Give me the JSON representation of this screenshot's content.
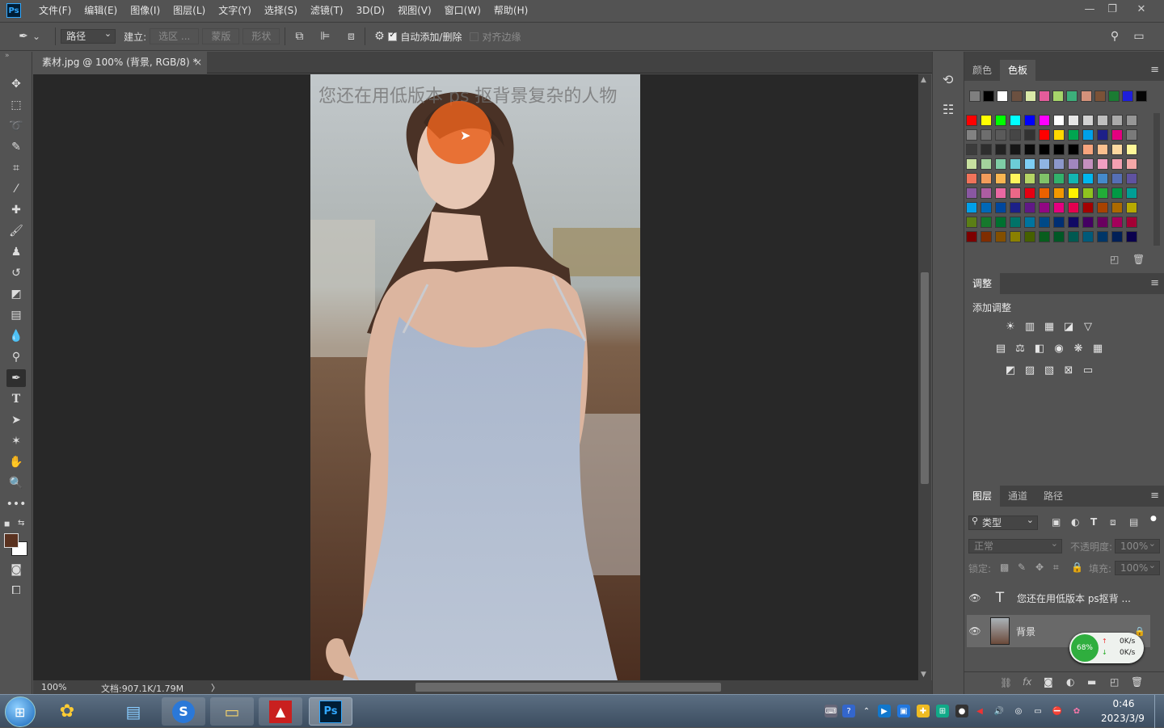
{
  "app": {
    "logo": "Ps"
  },
  "menu": [
    "文件(F)",
    "编辑(E)",
    "图像(I)",
    "图层(L)",
    "文字(Y)",
    "选择(S)",
    "滤镜(T)",
    "3D(D)",
    "视图(V)",
    "窗口(W)",
    "帮助(H)"
  ],
  "window_controls": {
    "minimize": "—",
    "restore": "❐",
    "close": "✕"
  },
  "options": {
    "mode_select": "路径",
    "make_label": "建立:",
    "selection_button": "选区 ...",
    "mask_button": "蒙版",
    "shape_button": "形状",
    "auto_add_delete": "自动添加/删除",
    "align_edges": "对齐边缘"
  },
  "document": {
    "tab_title": "素材.jpg @ 100% (背景, RGB/8) *",
    "tab_close": "×",
    "overlay_text": "您还在用低版本 ps 抠背景复杂的人物",
    "zoom": "100%",
    "doc_info": "文档:907.1K/1.79M",
    "status_arrow": "〉"
  },
  "swatches_panel": {
    "tabs": [
      "颜色",
      "色板"
    ],
    "active_tab": "色板",
    "colors": {
      "row1": [
        "#7f7f7f",
        "#000000",
        "#ffffff",
        "#6b5040",
        "#d9e8a8",
        "#e45c9a",
        "#a6d46a",
        "#3cae7a",
        "#d4927b",
        "#7b5237",
        "#1a7b32",
        "#1e1edc",
        "#050505"
      ],
      "grid": [
        [
          "#ff0000",
          "#ffff00",
          "#00ff00",
          "#00ffff",
          "#0000ff",
          "#ff00ff",
          "#ffffff",
          "#e6e6e6",
          "#d2d2d2",
          "#bebebe",
          "#aaaaaa",
          "#969696"
        ],
        [
          "#828282",
          "#6e6e6e",
          "#5a5a5a",
          "#464646",
          "#323232",
          "#ff0000",
          "#ffd700",
          "#00a550",
          "#00a0e9",
          "#1d2088",
          "#e4007f",
          "#7a7a7a"
        ],
        [
          "#3c3c3c",
          "#2e2e2e",
          "#222222",
          "#161616",
          "#0a0a0a",
          "#000000",
          "#000000",
          "#000000",
          "#f7a47d",
          "#fac08f",
          "#fcd8a0",
          "#fff799"
        ],
        [
          "#c8e1a0",
          "#a3d39c",
          "#7fcca6",
          "#6ccdd7",
          "#7ecef4",
          "#8fb4e3",
          "#8c97cb",
          "#a186be",
          "#c490bf",
          "#f19ec2",
          "#f4a0b1",
          "#f5a7a7"
        ],
        [
          "#f0735a",
          "#f39c5b",
          "#f8b551",
          "#fff45c",
          "#b4d465",
          "#80c269",
          "#32b16c",
          "#13b5b1",
          "#00b7ee",
          "#448aca",
          "#556fb5",
          "#5f52a0"
        ],
        [
          "#8957a1",
          "#ad5da1",
          "#ea68a2",
          "#ec6888",
          "#e60012",
          "#eb6100",
          "#f39800",
          "#fff100",
          "#8fc31f",
          "#22ac38",
          "#009944",
          "#009e96"
        ],
        [
          "#00a0e9",
          "#0068b7",
          "#00479d",
          "#1d2088",
          "#601986",
          "#920783",
          "#e4007f",
          "#e5004f",
          "#a40000",
          "#a84200",
          "#ac6a00",
          "#b7aa00"
        ],
        [
          "#5b7e16",
          "#16782c",
          "#007130",
          "#007368",
          "#00749e",
          "#004987",
          "#002e73",
          "#100964",
          "#440062",
          "#6a005f",
          "#a4005b",
          "#a40035"
        ],
        [
          "#7d0000",
          "#7f2d00",
          "#834f00",
          "#8a8000",
          "#466001",
          "#085d1d",
          "#005826",
          "#005951",
          "#005a7a",
          "#003668",
          "#001f57",
          "#0a004d"
        ]
      ]
    }
  },
  "adjustments_panel": {
    "tab": "调整",
    "add_label": "添加调整"
  },
  "layers_panel": {
    "tabs": [
      "图层",
      "通道",
      "路径"
    ],
    "active_tab": "图层",
    "filter_label": "类型",
    "blend_mode": "正常",
    "opacity_label": "不透明度:",
    "opacity_value": "100%",
    "lock_label": "锁定:",
    "fill_label": "填充:",
    "fill_value": "100%",
    "layers": [
      {
        "name": "您还在用低版本 ps抠背 ...",
        "type": "text"
      },
      {
        "name": "背景",
        "type": "image"
      }
    ]
  },
  "net_widget": {
    "percent": "68%",
    "up": "0K/s",
    "down": "0K/s"
  },
  "taskbar": {
    "time": "0:46",
    "date": "2023/3/9",
    "ps_label": "Ps"
  },
  "colors": {
    "foreground": "#5a3220",
    "background": "#ffffff",
    "accent": "#31a8ff"
  }
}
